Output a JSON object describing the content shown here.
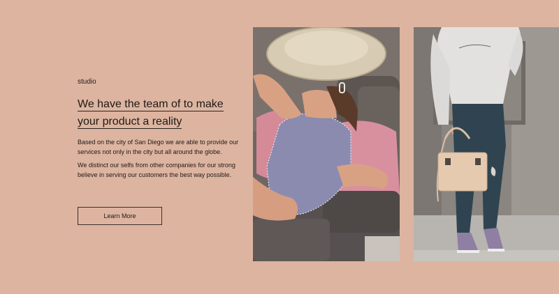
{
  "section": {
    "eyebrow": "studio",
    "headline_line1": "We have the team of to make",
    "headline_line2": "your product a reality",
    "paragraph1": "Based on the city of San Diego we are able to provide our services not only in the city but all around the globe.",
    "paragraph2": "We distinct our selfs from other companies for our strong believe in serving our customers the best way possible.",
    "button_label": "Learn More"
  },
  "colors": {
    "background": "#ddb4a0",
    "text": "#1f1a17"
  },
  "images": [
    {
      "name": "photo-woman-straw-hat-sofa"
    },
    {
      "name": "photo-woman-street-handbag"
    }
  ]
}
